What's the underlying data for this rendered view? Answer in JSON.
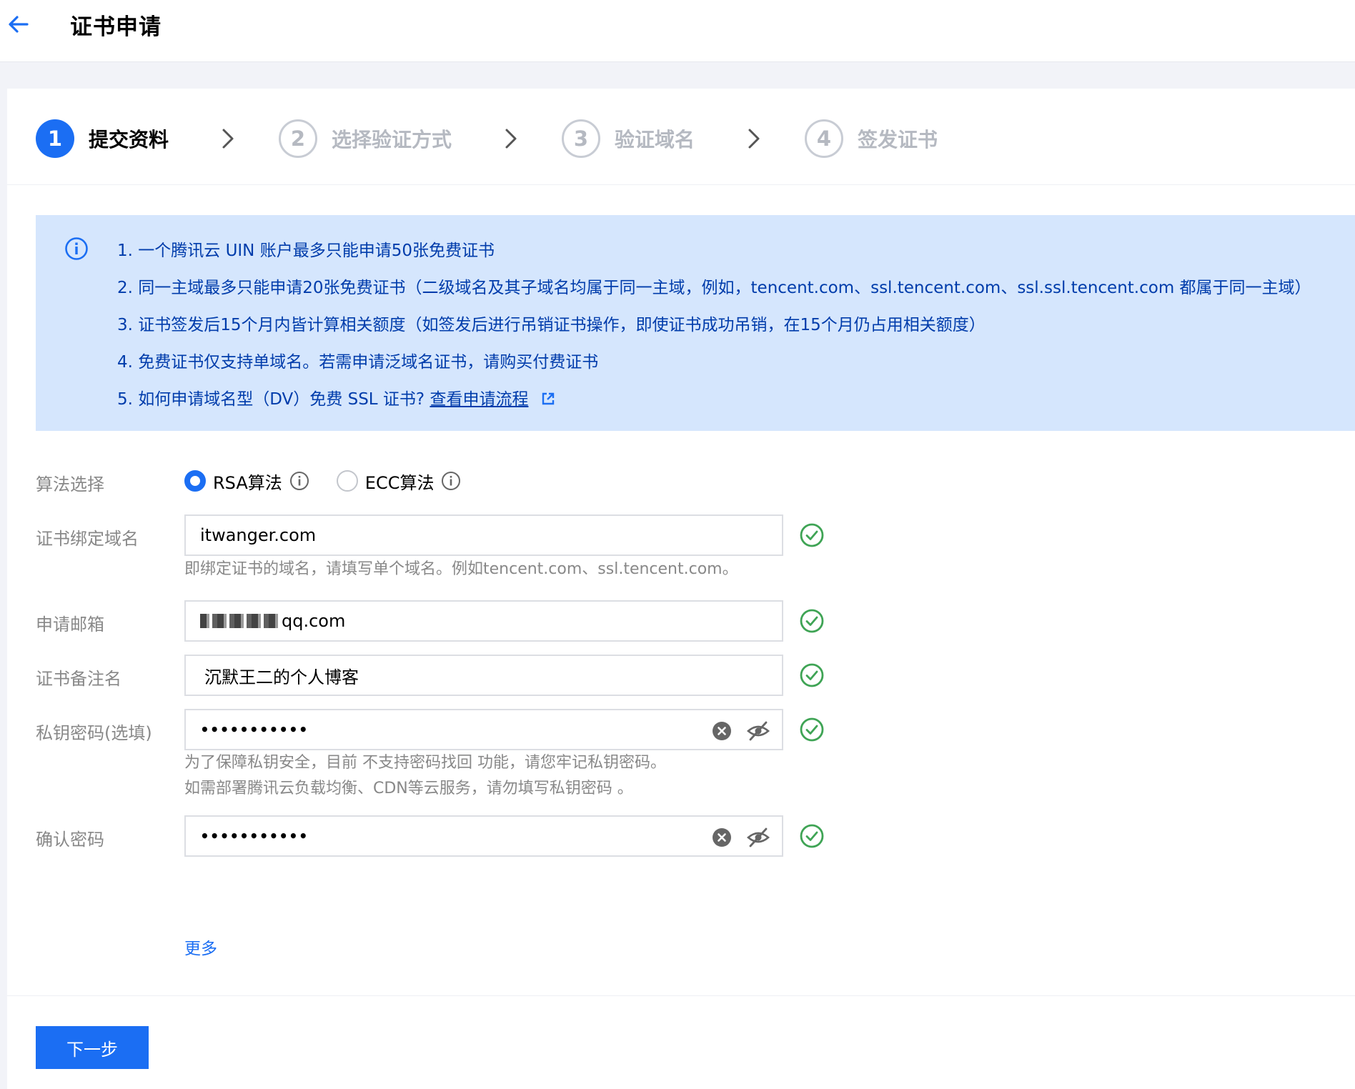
{
  "header": {
    "title": "证书申请"
  },
  "steps": [
    {
      "num": "1",
      "label": "提交资料"
    },
    {
      "num": "2",
      "label": "选择验证方式"
    },
    {
      "num": "3",
      "label": "验证域名"
    },
    {
      "num": "4",
      "label": "签发证书"
    }
  ],
  "notice": {
    "lines": [
      "1. 一个腾讯云 UIN 账户最多只能申请50张免费证书",
      "2. 同一主域最多只能申请20张免费证书（二级域名及其子域名均属于同一主域，例如，tencent.com、ssl.tencent.com、ssl.ssl.tencent.com 都属于同一主域）",
      "3. 证书签发后15个月内皆计算相关额度（如签发后进行吊销证书操作，即使证书成功吊销，在15个月仍占用相关额度）",
      "4. 免费证书仅支持单域名。若需申请泛域名证书，请购买付费证书"
    ],
    "line5_prefix": "5. 如何申请域名型（DV）免费 SSL 证书?",
    "line5_link": "查看申请流程"
  },
  "form": {
    "algorithm": {
      "label": "算法选择",
      "options": [
        "RSA算法",
        "ECC算法"
      ],
      "selected": "RSA算法"
    },
    "domain": {
      "label": "证书绑定域名",
      "value": "itwanger.com",
      "hint": "即绑定证书的域名，请填写单个域名。例如tencent.com、ssl.tencent.com。"
    },
    "email": {
      "label": "申请邮箱",
      "value_visible": "qq.com"
    },
    "remark": {
      "label": "证书备注名",
      "value": "沉默王二的个人博客"
    },
    "private_key_password": {
      "label": "私钥密码(选填)",
      "value": "•••••••••••",
      "hint_line1": "为了保障私钥安全，目前 不支持密码找回 功能，请您牢记私钥密码。",
      "hint_line2": "如需部署腾讯云负载均衡、CDN等云服务，请勿填写私钥密码 。"
    },
    "confirm_password": {
      "label": "确认密码",
      "value": "•••••••••••"
    },
    "more_label": "更多"
  },
  "footer": {
    "next_label": "下一步"
  },
  "colors": {
    "primary": "#1b6ef3",
    "notice_bg": "#d5e6fd",
    "success": "#3fa455"
  }
}
